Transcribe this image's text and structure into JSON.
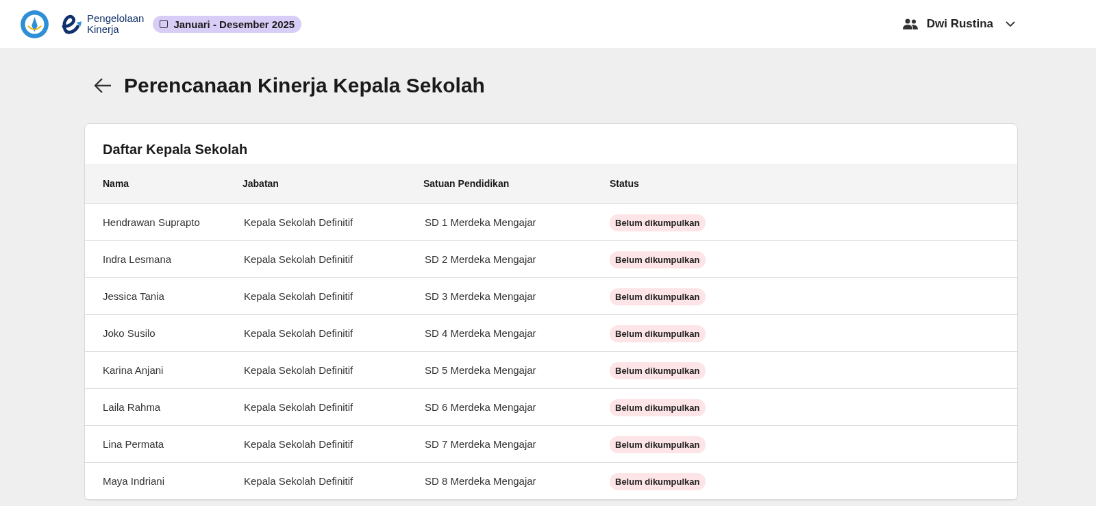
{
  "header": {
    "app_name": [
      "Pengelolaan",
      "Kinerja"
    ],
    "period": "Januari - Desember 2025",
    "user": "Dwi Rustina"
  },
  "page": {
    "title": "Perencanaan Kinerja Kepala Sekolah"
  },
  "card": {
    "title": "Daftar Kepala Sekolah",
    "table": {
      "columns": [
        "Nama",
        "Jabatan",
        "Satuan Pendidikan",
        "Status"
      ],
      "rows": [
        {
          "nama": "Hendrawan Suprapto",
          "jabatan": "Kepala Sekolah Definitif",
          "satuan": "SD 1 Merdeka Mengajar",
          "status": "Belum dikumpulkan"
        },
        {
          "nama": "Indra Lesmana",
          "jabatan": "Kepala Sekolah Definitif",
          "satuan": "SD 2 Merdeka Mengajar",
          "status": "Belum dikumpulkan"
        },
        {
          "nama": "Jessica Tania",
          "jabatan": "Kepala Sekolah Definitif",
          "satuan": "SD 3 Merdeka Mengajar",
          "status": "Belum dikumpulkan"
        },
        {
          "nama": "Joko Susilo",
          "jabatan": "Kepala Sekolah Definitif",
          "satuan": "SD 4 Merdeka Mengajar",
          "status": "Belum dikumpulkan"
        },
        {
          "nama": "Karina Anjani",
          "jabatan": "Kepala Sekolah Definitif",
          "satuan": "SD 5 Merdeka Mengajar",
          "status": "Belum dikumpulkan"
        },
        {
          "nama": "Laila Rahma",
          "jabatan": "Kepala Sekolah Definitif",
          "satuan": "SD 6 Merdeka Mengajar",
          "status": "Belum dikumpulkan"
        },
        {
          "nama": "Lina Permata",
          "jabatan": "Kepala Sekolah Definitif",
          "satuan": "SD 7 Merdeka Mengajar",
          "status": "Belum dikumpulkan"
        },
        {
          "nama": "Maya Indriani",
          "jabatan": "Kepala Sekolah Definitif",
          "satuan": "SD 8 Merdeka Mengajar",
          "status": "Belum dikumpulkan"
        }
      ]
    }
  }
}
